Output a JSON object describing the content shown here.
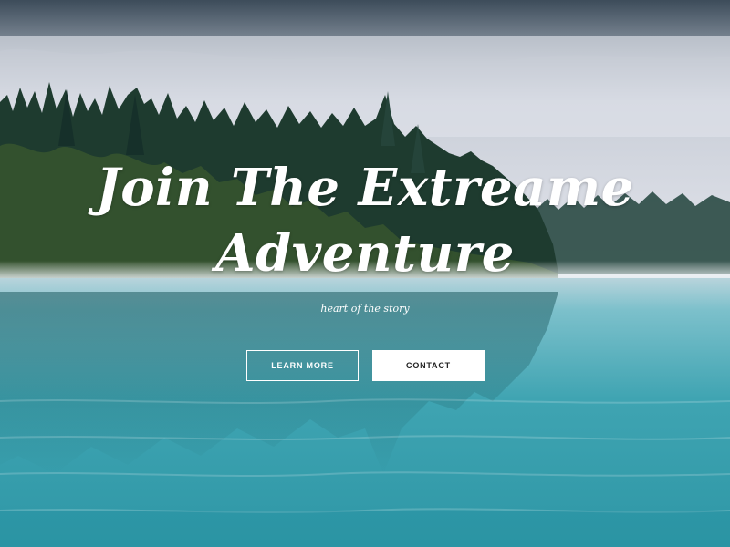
{
  "hero": {
    "headline_line1": "Join The Extreame",
    "headline_line2": "Adventure",
    "tagline": "heart of the story",
    "buttons": {
      "learn_more": "LEARN MORE",
      "contact": "CONTACT"
    }
  },
  "colors": {
    "text": "#ffffff",
    "water": "#3fa4b2",
    "forest": "#1e3b2f",
    "fog": "#e4e7ec",
    "button_text_dark": "#222222"
  }
}
